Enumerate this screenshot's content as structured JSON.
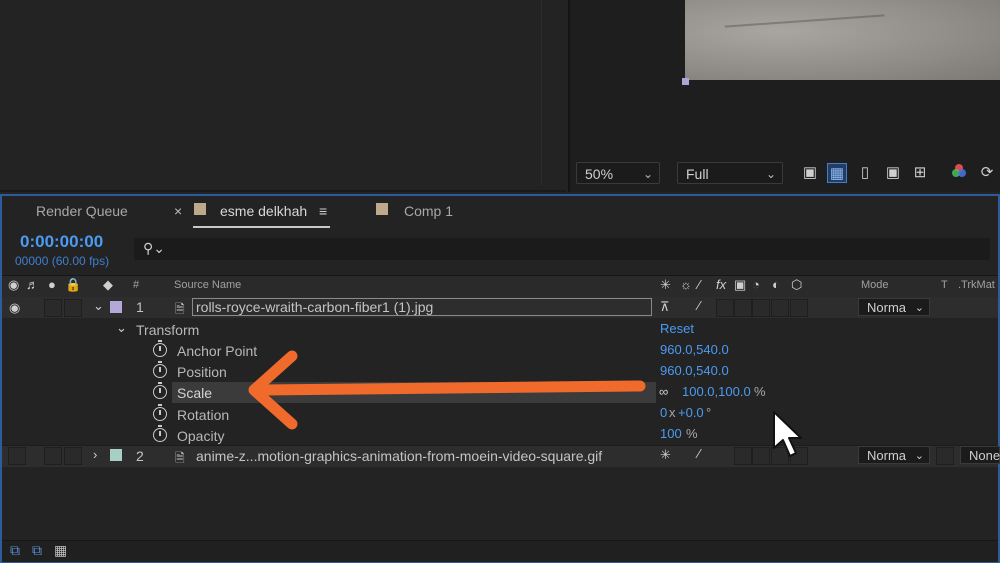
{
  "viewer": {
    "zoom_value": "50%",
    "resolution_value": "Full",
    "toolbar_icons": [
      "snapshot-icon",
      "transparency-grid-icon",
      "mask-path-icon",
      "region-of-interest-icon",
      "guides-icon",
      "color-channels-icon",
      "reset-exposure-icon"
    ]
  },
  "timeline": {
    "tabs": [
      {
        "label": "Render Queue"
      },
      {
        "label": "esme delkhah",
        "active": true
      },
      {
        "label": "Comp 1"
      }
    ],
    "timecode": "0:00:00:00",
    "frames": "00000 (60.00 fps)",
    "search_placeholder": "",
    "headers": {
      "hash": "#",
      "source_name": "Source Name",
      "mode": "Mode",
      "t": "T",
      "trkmat": ".TrkMat"
    },
    "layers": [
      {
        "number": "1",
        "name": "rolls-royce-wraith-carbon-fiber1 (1).jpg",
        "label_color": "#b3a8d8",
        "mode": "Norma",
        "expanded": true
      },
      {
        "number": "2",
        "name": "anime-z...motion-graphics-animation-from-moein-video-square.gif",
        "label_color": "#a9cfc4",
        "mode": "Norma",
        "trkmat": "None",
        "expanded": false
      }
    ],
    "transform": {
      "group_label": "Transform",
      "reset_label": "Reset",
      "properties": [
        {
          "label": "Anchor Point",
          "value": "960.0,540.0"
        },
        {
          "label": "Position",
          "value": "960.0,540.0"
        },
        {
          "label": "Scale",
          "value": "100.0,100.0",
          "unit": "%"
        },
        {
          "label": "Rotation",
          "value_a": "0",
          "value_sep": "x",
          "value_b": "+0.0",
          "unit": "°"
        },
        {
          "label": "Opacity",
          "value": "100",
          "unit": "%"
        }
      ]
    }
  },
  "colors": {
    "accent_blue": "#4b9bf2",
    "arrow_orange": "#f06a2c",
    "panel_border_active": "#2d5b9c"
  }
}
